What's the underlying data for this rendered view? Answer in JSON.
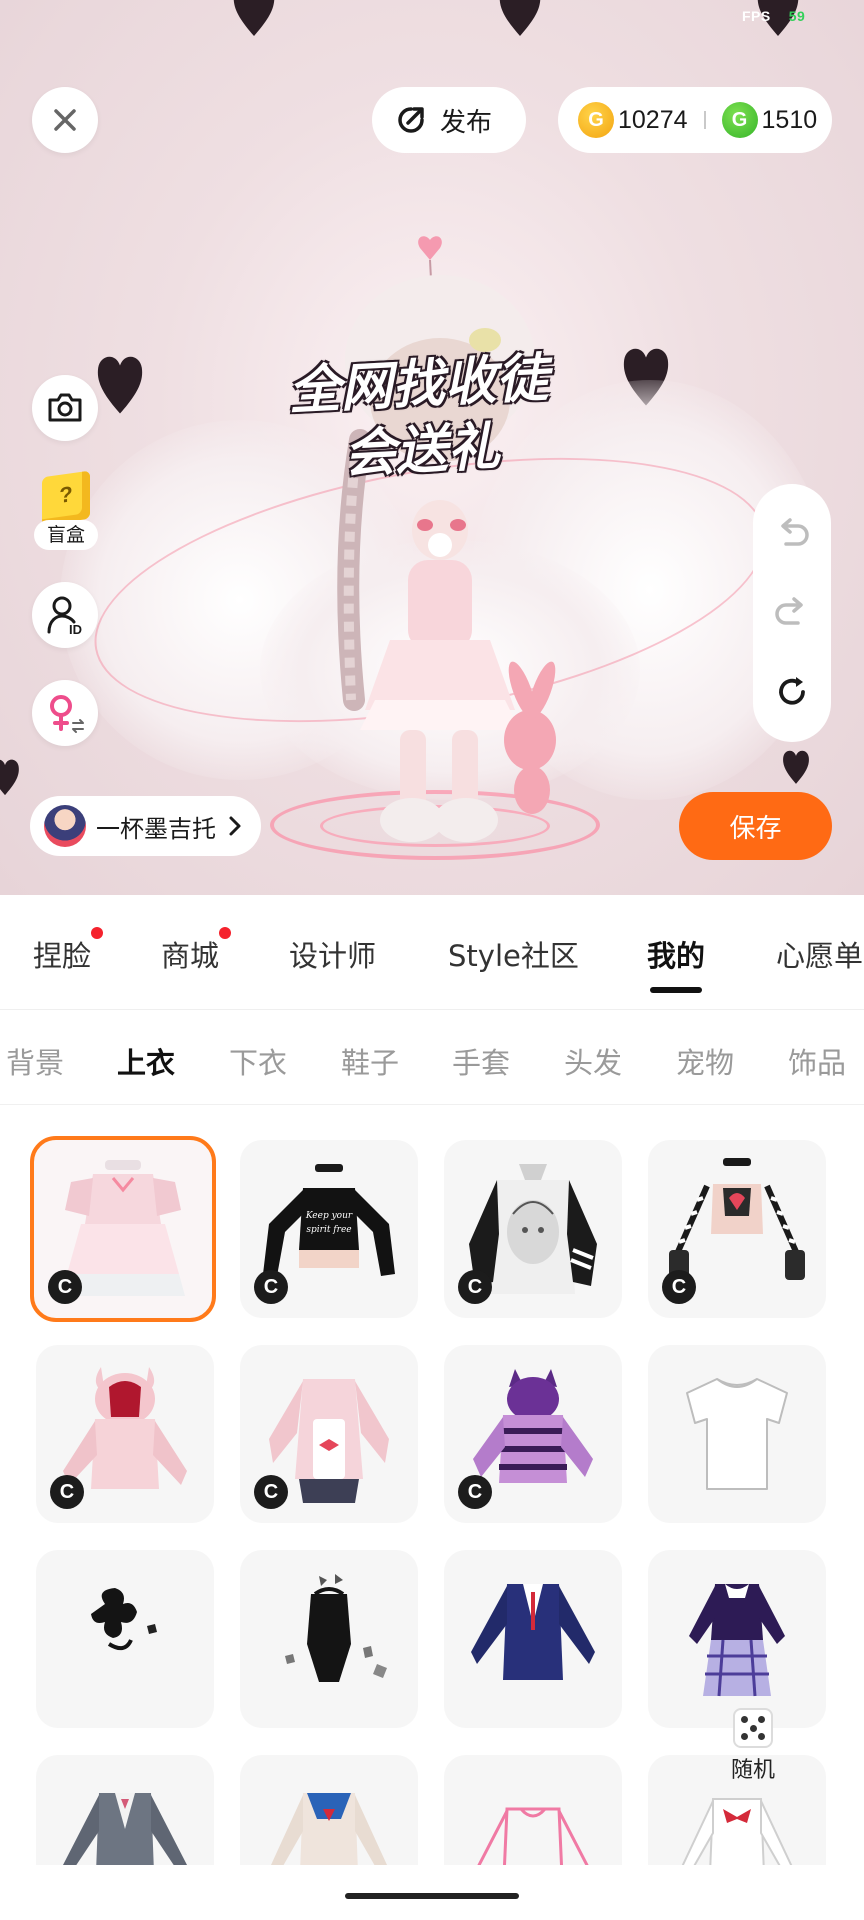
{
  "status": {
    "fps_label": "FPS",
    "fps_value": "59"
  },
  "header": {
    "publish_label": "发布",
    "gold_coins": "10274",
    "green_coins": "1510"
  },
  "stage": {
    "promo_line1": "全网找收徒",
    "promo_line2": "会送礼",
    "blindbox_label": "盲盒",
    "blindbox_mark": "?",
    "owner_name": "一杯墨吉托",
    "save_label": "保存"
  },
  "main_tabs": [
    {
      "label": "捏脸",
      "badge": true
    },
    {
      "label": "商城",
      "badge": true
    },
    {
      "label": "设计师",
      "badge": false
    },
    {
      "label": "Style社区",
      "badge": false
    },
    {
      "label": "我的",
      "badge": false,
      "active": true
    },
    {
      "label": "心愿单",
      "badge": false
    }
  ],
  "sub_tabs": [
    {
      "label": "背景"
    },
    {
      "label": "上衣",
      "active": true
    },
    {
      "label": "下衣"
    },
    {
      "label": "鞋子"
    },
    {
      "label": "手套"
    },
    {
      "label": "头发"
    },
    {
      "label": "宠物"
    },
    {
      "label": "饰品"
    }
  ],
  "items": [
    {
      "name": "pink-lolita-dress",
      "badge": "C",
      "selected": true
    },
    {
      "name": "black-crop-top-keep-your-spirit-free",
      "badge": "C",
      "print_text": "Keep your spirit free"
    },
    {
      "name": "anime-print-sweater",
      "badge": "C"
    },
    {
      "name": "striped-heart-crop-top",
      "badge": "C"
    },
    {
      "name": "pink-bunny-hoodie",
      "badge": "C"
    },
    {
      "name": "pink-maid-jacket",
      "badge": "C"
    },
    {
      "name": "purple-cat-hoodie",
      "badge": "C"
    },
    {
      "name": "white-tshirt",
      "badge": ""
    },
    {
      "name": "black-bow-piece",
      "badge": ""
    },
    {
      "name": "black-bodysuit",
      "badge": ""
    },
    {
      "name": "navy-blazer",
      "badge": ""
    },
    {
      "name": "purple-plaid-dress",
      "badge": ""
    },
    {
      "name": "grey-school-jacket",
      "badge": ""
    },
    {
      "name": "sailor-uniform",
      "badge": ""
    },
    {
      "name": "pink-outline-top",
      "badge": ""
    },
    {
      "name": "white-bow-shirt",
      "badge": ""
    }
  ],
  "random_label": "随机",
  "colors": {
    "accent": "#ff6a14",
    "selected_border": "#ff7a1a",
    "badge_dot": "#f5222d"
  }
}
